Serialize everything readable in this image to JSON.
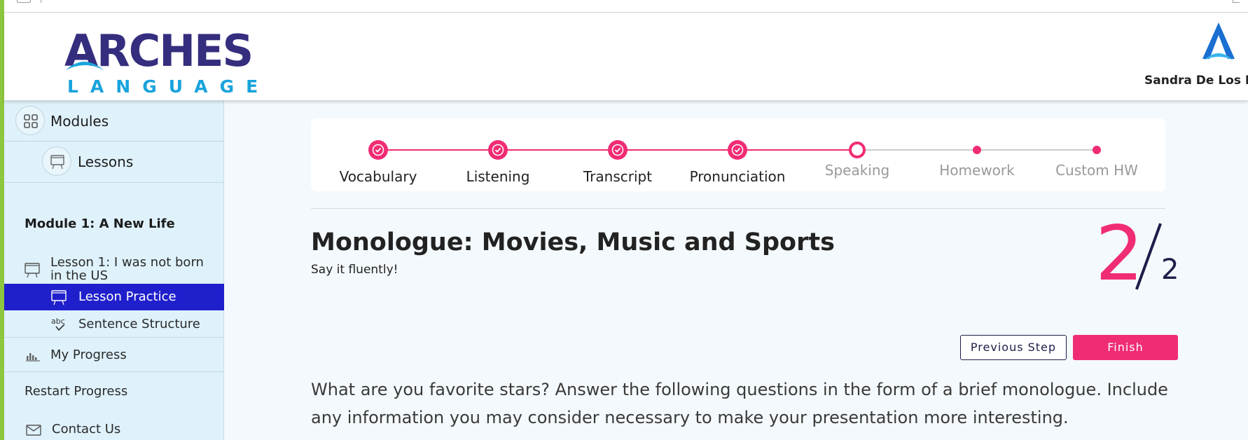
{
  "header": {
    "logo": {
      "main": "ARCHES",
      "sub": "LANGUAGE"
    },
    "user": {
      "name": "Sandra De Los Rey"
    }
  },
  "sidebar": {
    "modules_label": "Modules",
    "lessons_label": "Lessons",
    "module_title": "Module 1: A New Life",
    "lesson_title": "Lesson 1: I was not born in the US",
    "items": [
      {
        "label": "Lesson Practice",
        "icon": "presentation-board-icon",
        "active": true
      },
      {
        "label": "Sentence Structure",
        "icon": "abc-check-icon",
        "active": false
      }
    ],
    "my_progress": "My Progress",
    "restart_progress": "Restart Progress",
    "contact_us": "Contact Us"
  },
  "stepper": {
    "steps": [
      {
        "label": "Vocabulary",
        "state": "done"
      },
      {
        "label": "Listening",
        "state": "done"
      },
      {
        "label": "Transcript",
        "state": "done"
      },
      {
        "label": "Pronunciation",
        "state": "done"
      },
      {
        "label": "Speaking",
        "state": "current"
      },
      {
        "label": "Homework",
        "state": "upcoming"
      },
      {
        "label": "Custom HW",
        "state": "upcoming"
      }
    ],
    "colors": {
      "accent": "#f02c74",
      "inactive_text": "#999999",
      "inactive_line": "#cccccc"
    }
  },
  "content": {
    "title": "Monologue: Movies, Music and Sports",
    "subtitle": "Say it fluently!",
    "counter": {
      "current": "2",
      "total": "2"
    },
    "prompt": "What are you favorite stars? Answer the following questions in the form of a brief monologue. Include any information you may consider necessary to make your presentation more interesting."
  },
  "buttons": {
    "previous": "Previous Step",
    "finish": "Finish"
  },
  "theme": {
    "accent": "#f02c74",
    "sidebar_active": "#1f1fcc",
    "sidebar_bg": "#dff2fb",
    "brand_purple": "#352d7d",
    "brand_blue": "#1aa3dc",
    "left_bar": "#8dc63f"
  }
}
